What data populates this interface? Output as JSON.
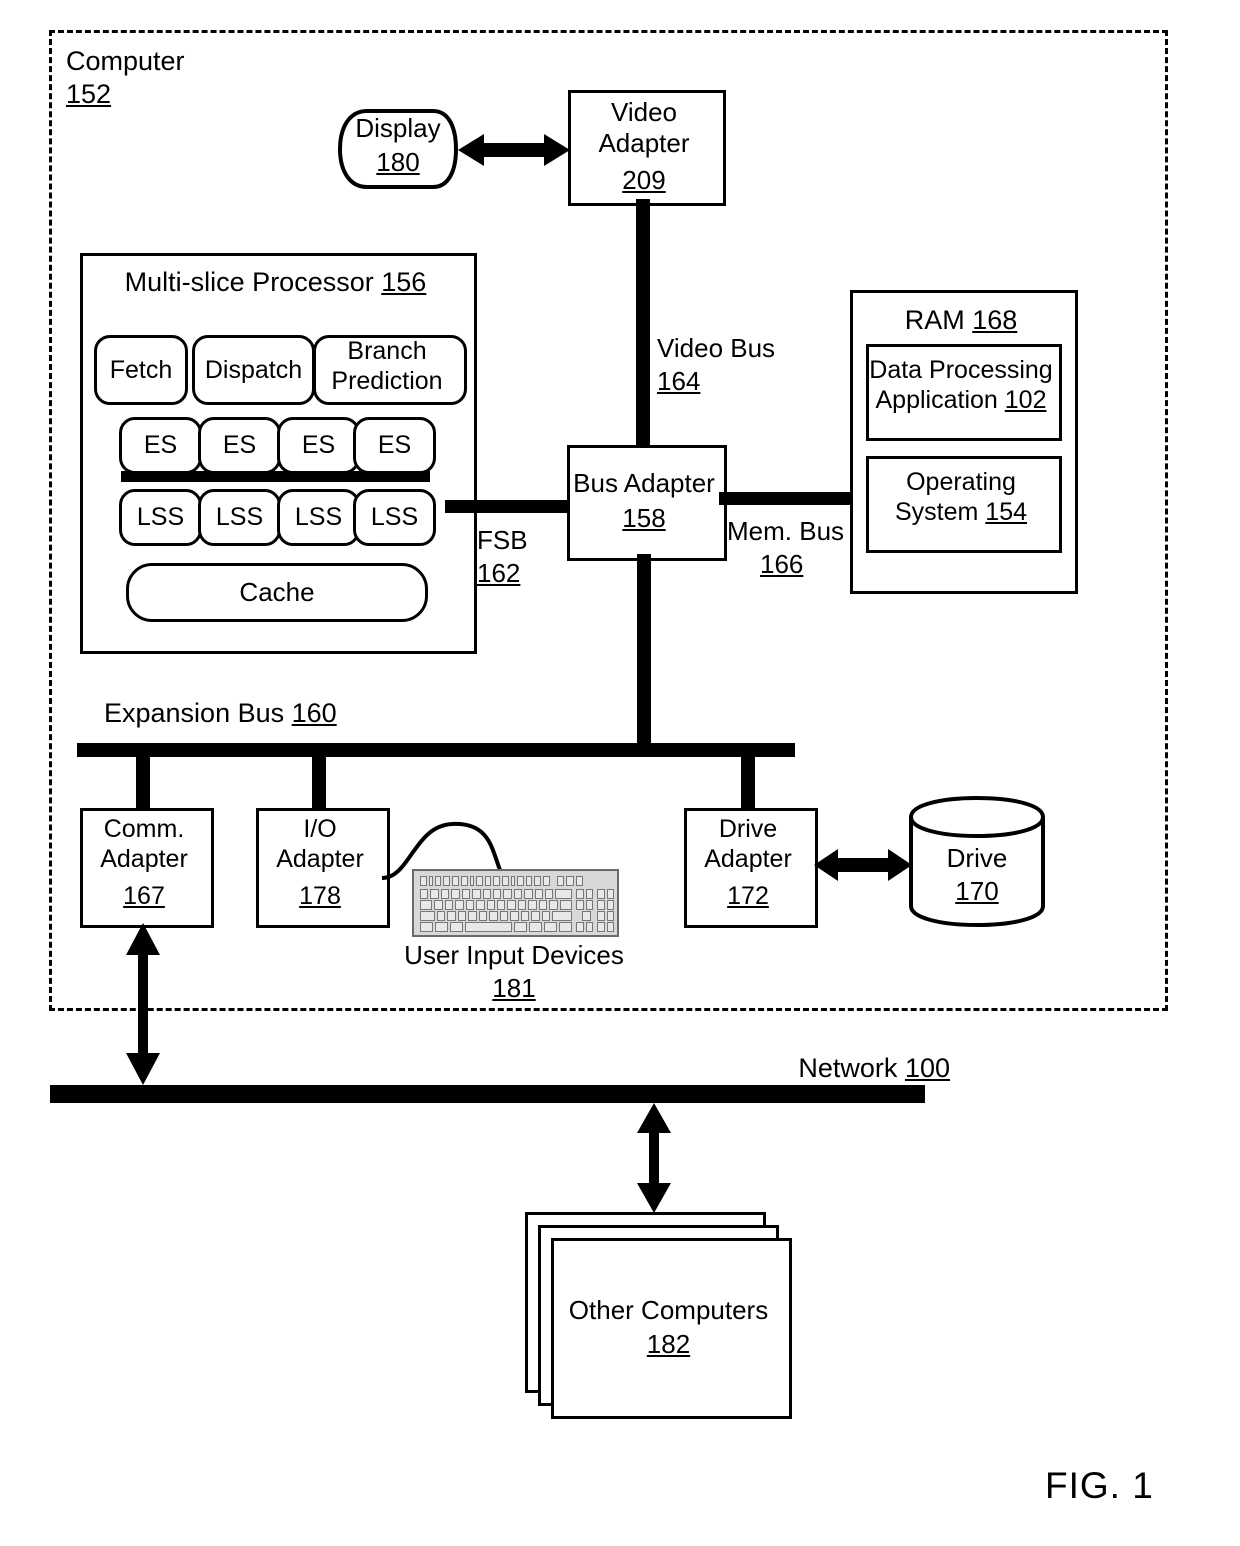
{
  "figure": {
    "caption": "FIG. 1"
  },
  "boundary": {
    "label": "Computer",
    "ref": "152"
  },
  "display": {
    "label": "Display",
    "ref": "180"
  },
  "video_adapter": {
    "line1": "Video",
    "line2": "Adapter",
    "ref": "209"
  },
  "video_bus": {
    "label": "Video Bus",
    "ref": "164"
  },
  "processor": {
    "title": "Multi-slice Processor",
    "ref": "156",
    "units_row1": [
      "Fetch",
      "Dispatch"
    ],
    "branch_prediction": {
      "line1": "Branch",
      "line2": "Prediction"
    },
    "es_units": [
      "ES",
      "ES",
      "ES",
      "ES"
    ],
    "lss_units": [
      "LSS",
      "LSS",
      "LSS",
      "LSS"
    ],
    "cache": "Cache"
  },
  "fsb": {
    "label": "FSB",
    "ref": "162"
  },
  "bus_adapter": {
    "label": "Bus Adapter",
    "ref": "158"
  },
  "mem_bus": {
    "label": "Mem. Bus",
    "ref": "166"
  },
  "ram": {
    "title": "RAM",
    "ref": "168",
    "items": [
      {
        "line1": "Data Processing",
        "line2": "Application",
        "ref": "102"
      },
      {
        "line1": "Operating",
        "line2": "System",
        "ref": "154"
      }
    ]
  },
  "expansion_bus": {
    "label": "Expansion Bus",
    "ref": "160"
  },
  "comm_adapter": {
    "line1": "Comm.",
    "line2": "Adapter",
    "ref": "167"
  },
  "io_adapter": {
    "line1": "I/O",
    "line2": "Adapter",
    "ref": "178"
  },
  "user_input_devices": {
    "label": "User Input Devices",
    "ref": "181"
  },
  "drive_adapter": {
    "line1": "Drive",
    "line2": "Adapter",
    "ref": "172"
  },
  "drive": {
    "label": "Drive",
    "ref": "170"
  },
  "network": {
    "label": "Network",
    "ref": "100"
  },
  "other_computers": {
    "label": "Other Computers",
    "ref": "182"
  }
}
